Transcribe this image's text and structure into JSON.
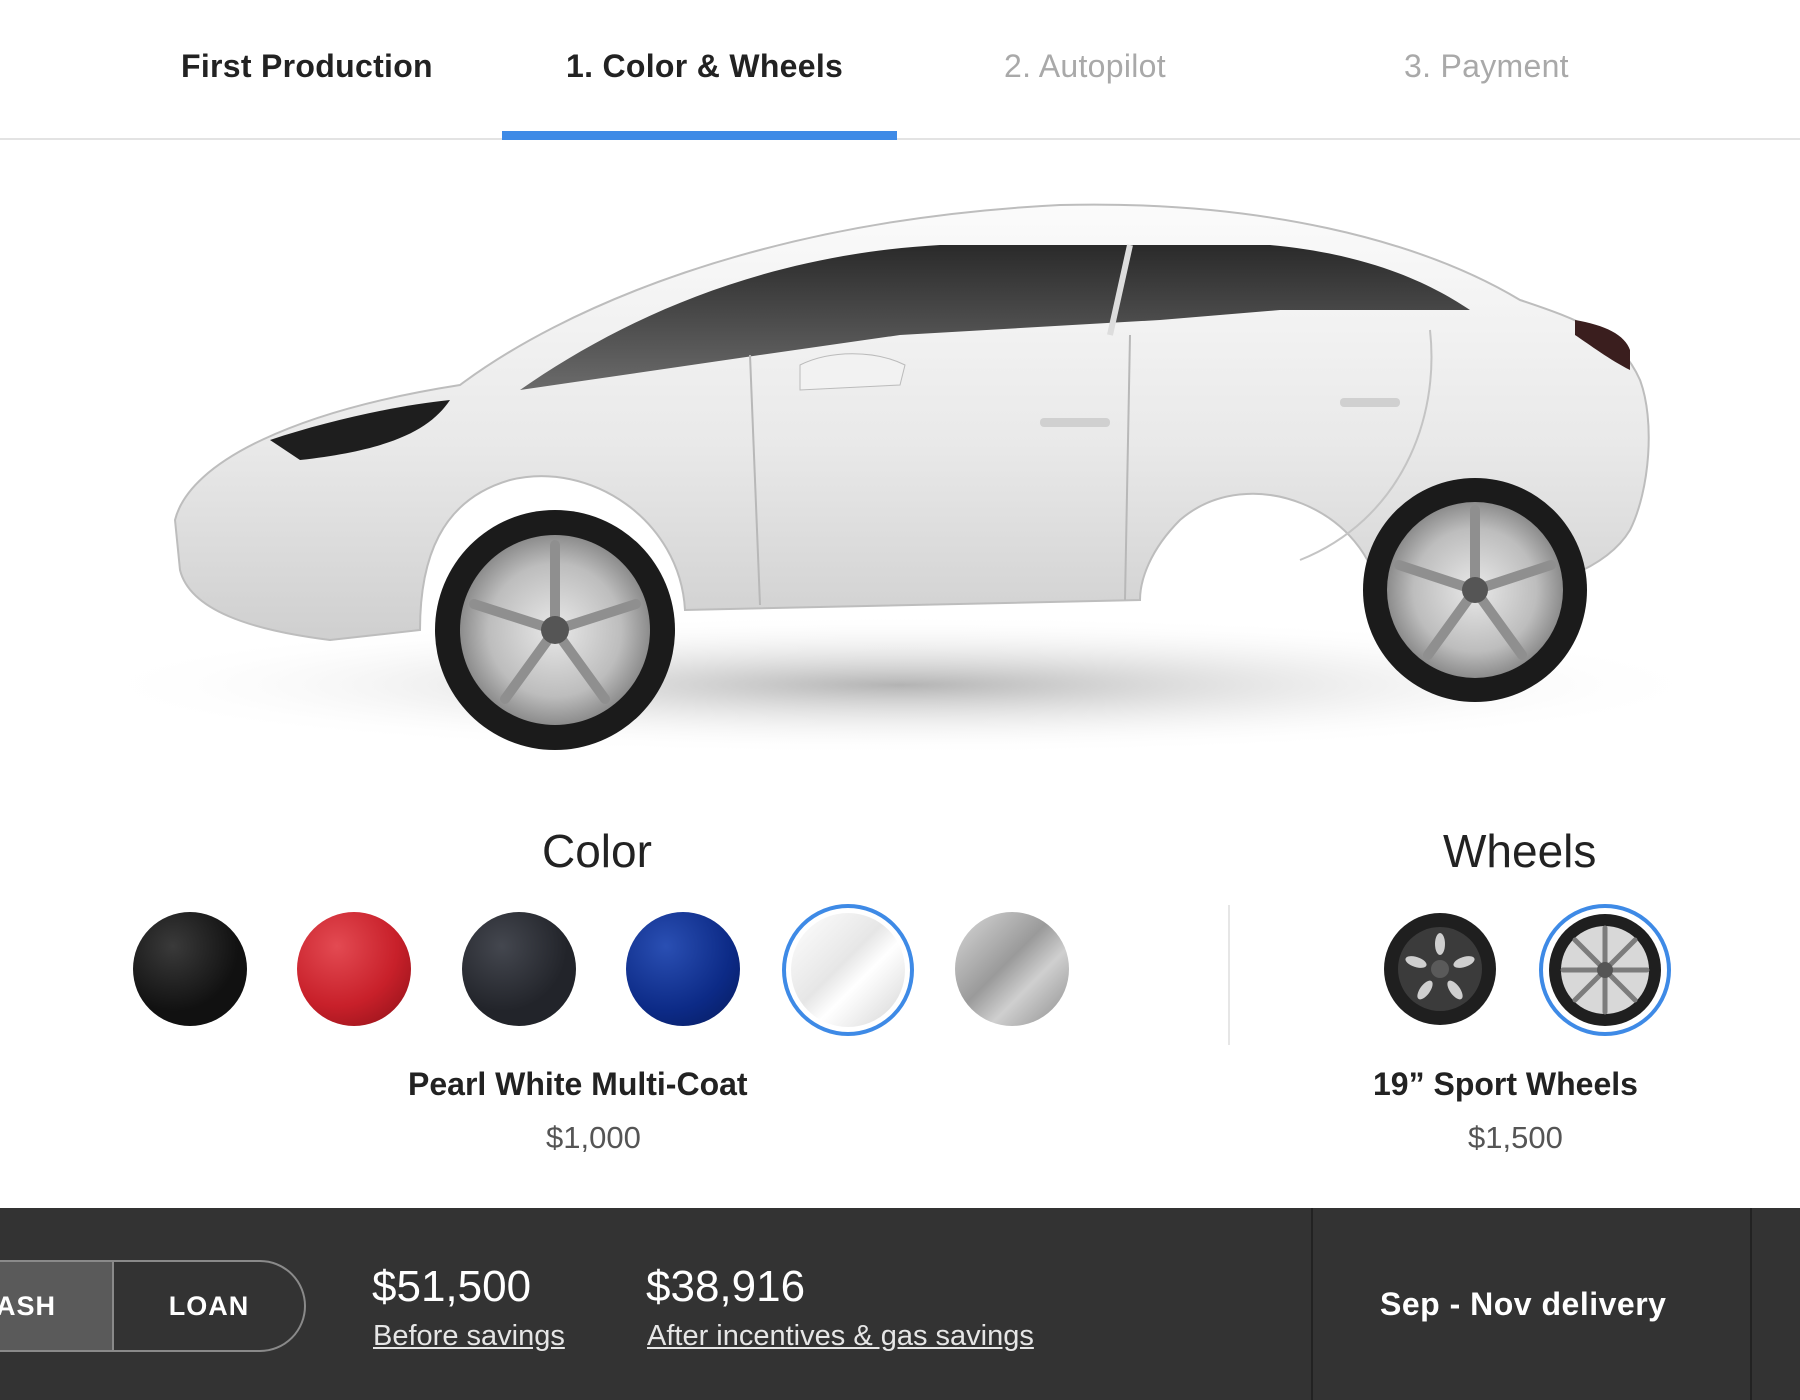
{
  "steps": {
    "items": [
      {
        "label": "First Production",
        "state": "done"
      },
      {
        "label": "1. Color & Wheels",
        "state": "active"
      },
      {
        "label": "2. Autopilot",
        "state": "todo"
      },
      {
        "label": "3. Payment",
        "state": "todo"
      }
    ],
    "accent_color": "#3e8ae6"
  },
  "hero": {
    "image": "car-side-profile",
    "car_color": "#ededed"
  },
  "color_section": {
    "title": "Color",
    "swatches": [
      {
        "name": "black-swatch",
        "color": "#111111"
      },
      {
        "name": "red-swatch",
        "color": "#c8202a"
      },
      {
        "name": "midnight-silver-swatch",
        "color": "#22242a"
      },
      {
        "name": "deep-blue-swatch",
        "color": "#0c2a86"
      },
      {
        "name": "pearl-white-swatch",
        "color": "#f1f1f1",
        "selected": true
      },
      {
        "name": "silver-swatch",
        "color": "#a9a9a9"
      }
    ],
    "selected_name": "Pearl White Multi-Coat",
    "selected_price": "$1,000"
  },
  "wheels_section": {
    "title": "Wheels",
    "options": [
      {
        "name": "aero-wheel-option",
        "selected": false
      },
      {
        "name": "sport-wheel-option",
        "selected": true
      }
    ],
    "selected_name": "19” Sport Wheels",
    "selected_price": "$1,500"
  },
  "bottom_bar": {
    "payment_toggle": {
      "cash_label": "ASH",
      "loan_label": "LOAN",
      "active": "cash"
    },
    "price_before": "$51,500",
    "price_before_label": "Before savings",
    "price_after": "$38,916",
    "price_after_label": "After incentives & gas savings",
    "delivery": "Sep - Nov delivery",
    "background": "#333333"
  }
}
